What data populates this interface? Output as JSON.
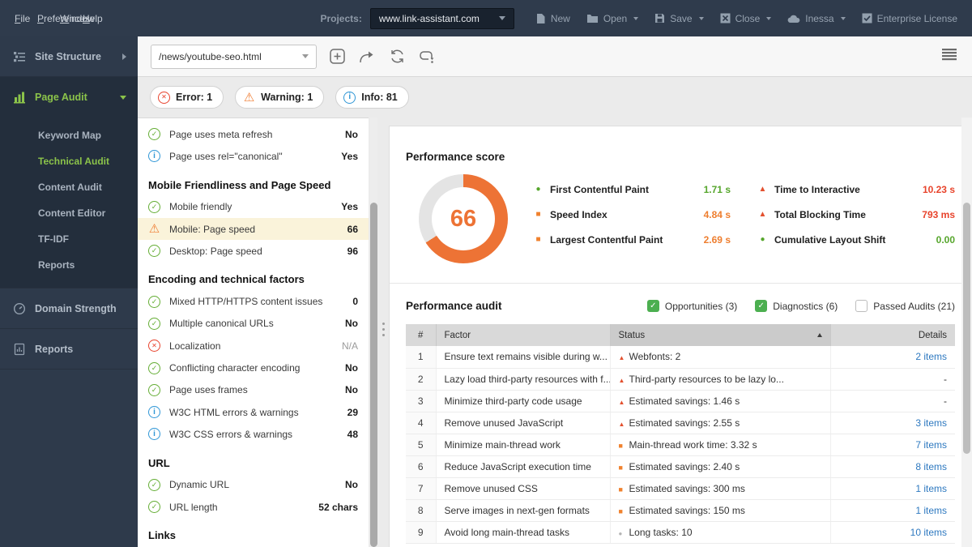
{
  "colors": {
    "accent_orange": "#ed7335",
    "success_green": "#56a62c",
    "error_red": "#e8442c",
    "info_blue": "#2e96d6",
    "link_blue": "#2e79c0",
    "active_green": "#8bc34a",
    "donut_rest_gray": "#e4e4e4",
    "highlight_cream": "#faf3da"
  },
  "menubar": {
    "items": [
      "File",
      "Preferences",
      "Window",
      "Help"
    ],
    "projects_label": "Projects:",
    "project_selected": "www.link-assistant.com",
    "actions": [
      {
        "label": "New",
        "icon": "new-file-icon",
        "dropdown": false
      },
      {
        "label": "Open",
        "icon": "open-folder-icon",
        "dropdown": true
      },
      {
        "label": "Save",
        "icon": "save-icon",
        "dropdown": true
      },
      {
        "label": "Close",
        "icon": "close-project-icon",
        "dropdown": true
      },
      {
        "label": "Inessa",
        "icon": "account-cloud-icon",
        "dropdown": true
      },
      {
        "label": "Enterprise License",
        "icon": "license-check-icon",
        "dropdown": false
      }
    ]
  },
  "sidebar": {
    "items": [
      {
        "label": "Site Structure",
        "icon": "site-structure-icon"
      },
      {
        "label": "Page Audit",
        "icon": "page-audit-icon",
        "active": true
      },
      {
        "label": "Domain Strength",
        "icon": "gauge-icon"
      },
      {
        "label": "Reports",
        "icon": "report-icon"
      }
    ],
    "page_audit_children": [
      {
        "label": "Keyword Map"
      },
      {
        "label": "Technical Audit",
        "active": true
      },
      {
        "label": "Content Audit"
      },
      {
        "label": "Content Editor"
      },
      {
        "label": "TF-IDF"
      },
      {
        "label": "Reports"
      }
    ]
  },
  "toolbar": {
    "url_value": "/news/youtube-seo.html",
    "icons": [
      "add-page-icon",
      "submit-arrow-icon",
      "sync-icon",
      "rebuild-icon",
      "menu-hamburger-icon"
    ]
  },
  "status_chips": [
    {
      "label": "Error: 1",
      "icon": "error"
    },
    {
      "label": "Warning: 1",
      "icon": "warn"
    },
    {
      "label": "Info: 81",
      "icon": "info"
    }
  ],
  "factors": [
    {
      "kind": "item",
      "icon": "ok",
      "label": "Page uses meta refresh",
      "value": "No"
    },
    {
      "kind": "item",
      "icon": "info",
      "label": "Page uses rel=\"canonical\"",
      "value": "Yes"
    },
    {
      "kind": "section",
      "label": "Mobile Friendliness and Page Speed"
    },
    {
      "kind": "item",
      "icon": "ok",
      "label": "Mobile friendly",
      "value": "Yes"
    },
    {
      "kind": "item",
      "icon": "warn",
      "label": "Mobile: Page speed",
      "value": "66",
      "highlight": true
    },
    {
      "kind": "item",
      "icon": "ok",
      "label": "Desktop: Page speed",
      "value": "96"
    },
    {
      "kind": "section",
      "label": "Encoding and technical factors"
    },
    {
      "kind": "item",
      "icon": "ok",
      "label": "Mixed HTTP/HTTPS content issues",
      "value": "0"
    },
    {
      "kind": "item",
      "icon": "ok",
      "label": "Multiple canonical URLs",
      "value": "No"
    },
    {
      "kind": "item",
      "icon": "error",
      "label": "Localization",
      "value": "N/A",
      "muted": true
    },
    {
      "kind": "item",
      "icon": "ok",
      "label": "Conflicting character encoding",
      "value": "No"
    },
    {
      "kind": "item",
      "icon": "ok",
      "label": "Page uses frames",
      "value": "No"
    },
    {
      "kind": "item",
      "icon": "info",
      "label": "W3C HTML errors & warnings",
      "value": "29"
    },
    {
      "kind": "item",
      "icon": "info",
      "label": "W3C CSS errors & warnings",
      "value": "48"
    },
    {
      "kind": "section",
      "label": "URL"
    },
    {
      "kind": "item",
      "icon": "ok",
      "label": "Dynamic URL",
      "value": "No"
    },
    {
      "kind": "item",
      "icon": "ok",
      "label": "URL length",
      "value": "52 chars"
    },
    {
      "kind": "section",
      "label": "Links"
    }
  ],
  "performance_score": {
    "title": "Performance score",
    "score": 66,
    "metrics_left": [
      {
        "icon": "dot-green",
        "label": "First Contentful Paint",
        "value": "1.71 s",
        "value_color": "#56a62c"
      },
      {
        "icon": "square-orange",
        "label": "Speed Index",
        "value": "4.84 s",
        "value_color": "#ee7e2f"
      },
      {
        "icon": "square-orange",
        "label": "Largest Contentful Paint",
        "value": "2.69 s",
        "value_color": "#ee7e2f"
      }
    ],
    "metrics_right": [
      {
        "icon": "triangle-red",
        "label": "Time to Interactive",
        "value": "10.23 s",
        "value_color": "#e8442c"
      },
      {
        "icon": "triangle-red",
        "label": "Total Blocking Time",
        "value": "793 ms",
        "value_color": "#e8442c"
      },
      {
        "icon": "dot-green",
        "label": "Cumulative Layout Shift",
        "value": "0.00",
        "value_color": "#56a62c"
      }
    ]
  },
  "performance_audit": {
    "title": "Performance audit",
    "filters": [
      {
        "label": "Opportunities (3)",
        "checked": true
      },
      {
        "label": "Diagnostics (6)",
        "checked": true
      },
      {
        "label": "Passed Audits (21)",
        "checked": false
      }
    ],
    "columns": [
      "#",
      "Factor",
      "Status",
      "Details"
    ],
    "sorted_column": "Status",
    "rows": [
      {
        "num": "1",
        "factor": "Ensure text remains visible during w...",
        "status_icon": "triangle",
        "status": "Webfonts: 2",
        "details": "2 items",
        "details_link": true
      },
      {
        "num": "2",
        "factor": "Lazy load third-party resources with f...",
        "status_icon": "triangle",
        "status": "Third-party resources to be lazy lo...",
        "details": "-",
        "details_link": false
      },
      {
        "num": "3",
        "factor": "Minimize third-party code usage",
        "status_icon": "triangle",
        "status": "Estimated savings: 1.46 s",
        "details": "-",
        "details_link": false
      },
      {
        "num": "4",
        "factor": "Remove unused JavaScript",
        "status_icon": "triangle",
        "status": "Estimated savings: 2.55 s",
        "details": "3 items",
        "details_link": true
      },
      {
        "num": "5",
        "factor": "Minimize main-thread work",
        "status_icon": "square",
        "status": "Main-thread work time: 3.32 s",
        "details": "7 items",
        "details_link": true
      },
      {
        "num": "6",
        "factor": "Reduce JavaScript execution time",
        "status_icon": "square",
        "status": "Estimated savings: 2.40 s",
        "details": "8 items",
        "details_link": true
      },
      {
        "num": "7",
        "factor": "Remove unused CSS",
        "status_icon": "square",
        "status": "Estimated savings: 300 ms",
        "details": "1 items",
        "details_link": true
      },
      {
        "num": "8",
        "factor": "Serve images in next-gen formats",
        "status_icon": "square",
        "status": "Estimated savings: 150 ms",
        "details": "1 items",
        "details_link": true
      },
      {
        "num": "9",
        "factor": "Avoid long main-thread tasks",
        "status_icon": "dot",
        "status": "Long tasks: 10",
        "details": "10 items",
        "details_link": true
      }
    ]
  }
}
